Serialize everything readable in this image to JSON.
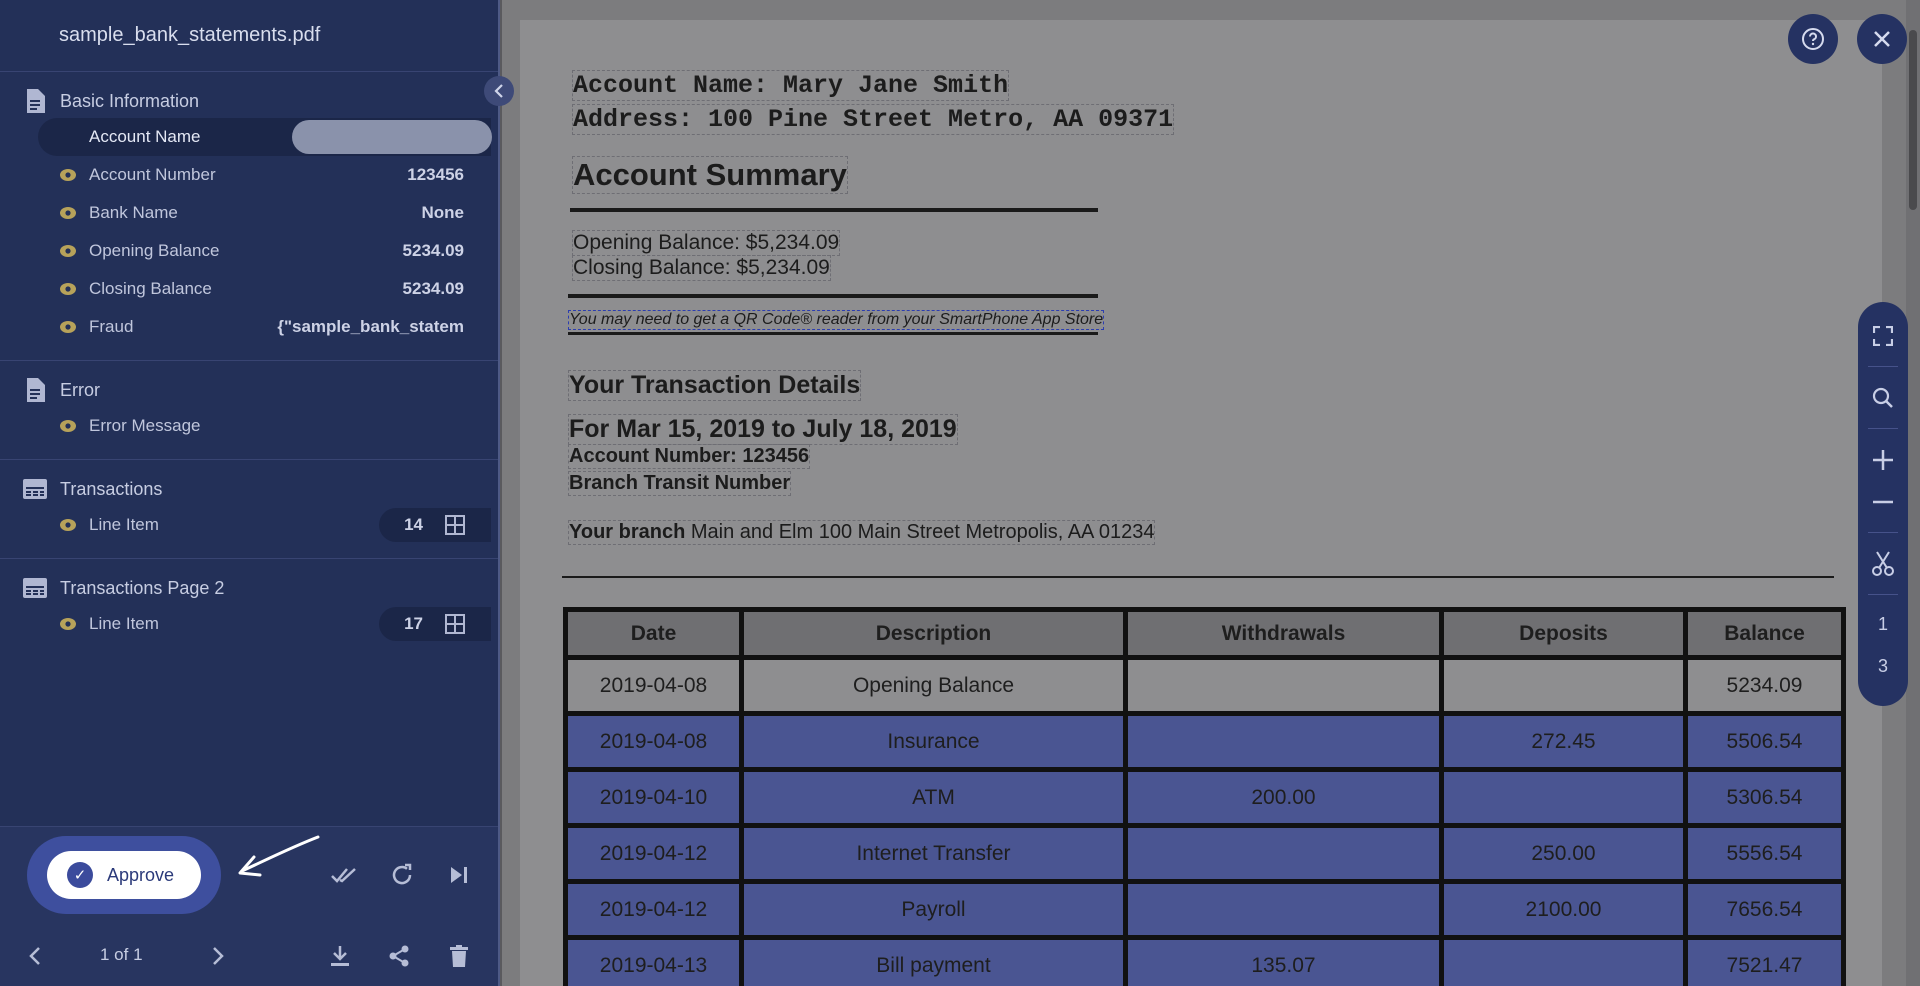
{
  "sidebar": {
    "file_name": "sample_bank_statements.pdf",
    "sections": [
      {
        "title": "Basic Information",
        "icon": "document-icon",
        "fields": [
          {
            "label": "Account Name",
            "value": ""
          },
          {
            "label": "Account Number",
            "value": "123456"
          },
          {
            "label": "Bank Name",
            "value": "None"
          },
          {
            "label": "Opening Balance",
            "value": "5234.09"
          },
          {
            "label": "Closing Balance",
            "value": "5234.09"
          },
          {
            "label": "Fraud",
            "value": "{\"sample_bank_statem"
          }
        ]
      },
      {
        "title": "Error",
        "icon": "document-icon",
        "fields": [
          {
            "label": "Error Message",
            "value": ""
          }
        ]
      },
      {
        "title": "Transactions",
        "icon": "table-icon",
        "fields": [
          {
            "label": "Line Item",
            "count": "14"
          }
        ]
      },
      {
        "title": "Transactions Page 2",
        "icon": "table-icon",
        "fields": [
          {
            "label": "Line Item",
            "count": "17"
          }
        ]
      }
    ]
  },
  "bottom_bar": {
    "approve_label": "Approve",
    "page_indicator": "1 of 1"
  },
  "document": {
    "account_name_line": "Account Name: Mary Jane Smith",
    "address_line": "Address: 100 Pine Street Metro, AA 09371",
    "summary_title": "Account Summary",
    "opening_balance": "Opening Balance: $5,234.09",
    "closing_balance": "Closing Balance: $5,234.09",
    "qr_note": "You may need to get a QR Code® reader from your SmartPhone App Store",
    "tx_details_title": "Your Transaction Details",
    "period": "For Mar 15, 2019 to July 18, 2019",
    "account_number": "Account Number: 123456",
    "branch_transit": "Branch Transit Number",
    "branch_label": "Your branch",
    "branch_address": "Main and Elm 100 Main Street Metropolis, AA 01234",
    "table": {
      "headers": [
        "Date",
        "Description",
        "Withdrawals",
        "Deposits",
        "Balance"
      ],
      "rows": [
        [
          "2019-04-08",
          "Opening Balance",
          "",
          "",
          "5234.09"
        ],
        [
          "2019-04-08",
          "Insurance",
          "",
          "272.45",
          "5506.54"
        ],
        [
          "2019-04-10",
          "ATM",
          "200.00",
          "",
          "5306.54"
        ],
        [
          "2019-04-12",
          "Internet Transfer",
          "",
          "250.00",
          "5556.54"
        ],
        [
          "2019-04-12",
          "Payroll",
          "",
          "2100.00",
          "7656.54"
        ],
        [
          "2019-04-13",
          "Bill payment",
          "135.07",
          "",
          "7521.47"
        ]
      ]
    }
  },
  "toolbar": {
    "page_current": "1",
    "page_total": "3"
  },
  "colors": {
    "sidebar_bg": "#233058",
    "accent": "#3e4f9e",
    "highlight": "#4a5592",
    "eye_icon": "#b7a25a"
  }
}
